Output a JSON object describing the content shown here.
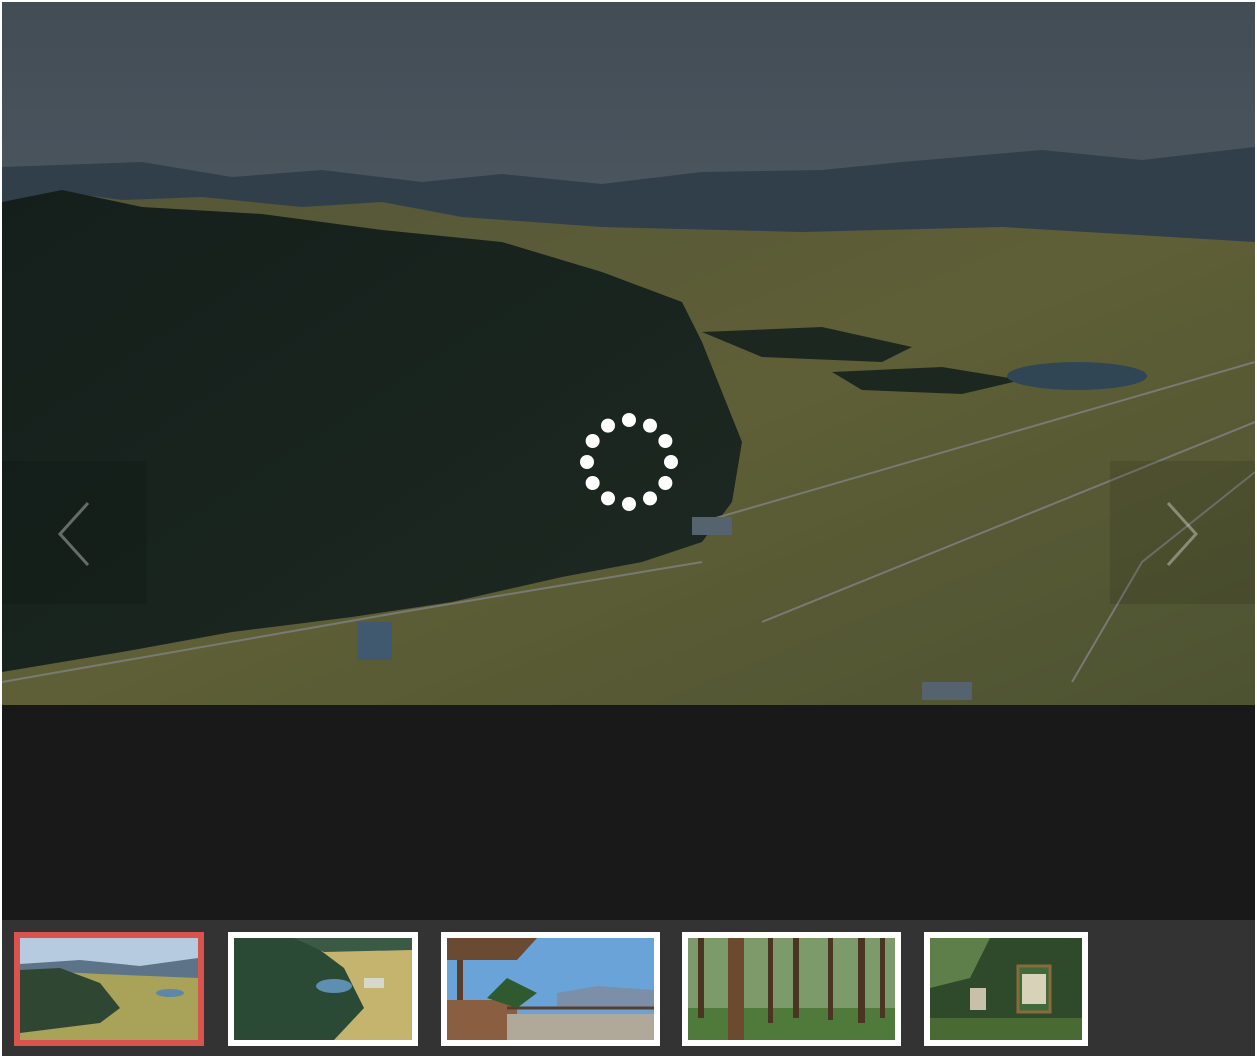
{
  "viewer": {
    "loading": true,
    "current_index": 0,
    "icons": {
      "prev": "chevron-left-icon",
      "next": "chevron-right-icon",
      "loader": "loading-spinner-icon"
    },
    "colors": {
      "active_thumb_border": "#d9534f",
      "thumb_border": "#ffffff",
      "strip_background": "#333333",
      "viewer_background": "#191919"
    }
  },
  "thumbnails": [
    {
      "subject": "valley-view",
      "selected": true
    },
    {
      "subject": "aerial-forest",
      "selected": false
    },
    {
      "subject": "observation-deck",
      "selected": false
    },
    {
      "subject": "cedar-forest",
      "selected": false
    },
    {
      "subject": "trail-signboard",
      "selected": false
    }
  ]
}
